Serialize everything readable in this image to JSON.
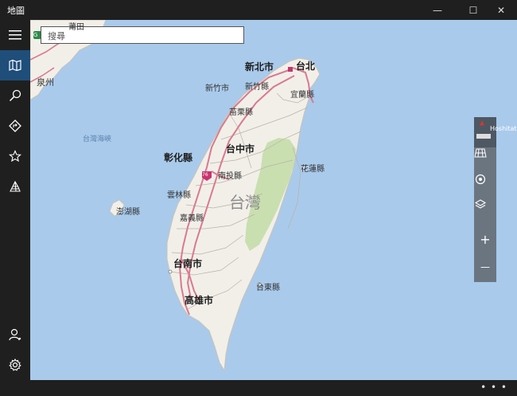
{
  "app": {
    "title": "地圖"
  },
  "window_controls": {
    "minimize": "—",
    "maximize": "☐",
    "close": "✕"
  },
  "search": {
    "placeholder": "搜尋"
  },
  "sidebar": {
    "items": [
      {
        "name": "hamburger-menu-icon",
        "active": false
      },
      {
        "name": "map-icon",
        "active": true
      },
      {
        "name": "search-icon",
        "active": false
      },
      {
        "name": "directions-icon",
        "active": false
      },
      {
        "name": "favorites-star-icon",
        "active": false
      },
      {
        "name": "3d-cities-icon",
        "active": false
      }
    ],
    "bottom_items": [
      {
        "name": "account-icon"
      },
      {
        "name": "settings-gear-icon"
      }
    ]
  },
  "map": {
    "labels": {
      "taipei": "台北",
      "new_taipei": "新北市",
      "hsinchu_city": "新竹市",
      "hsinchu_county": "新竹縣",
      "yilan": "宜蘭縣",
      "miaoli": "苗栗縣",
      "taichung": "台中市",
      "changhua": "彰化縣",
      "nantou": "南投縣",
      "hualien": "花蓮縣",
      "yunlin": "雲林縣",
      "chiayi": "嘉義縣",
      "penghu": "澎湖縣",
      "tainan": "台南市",
      "kaohsiung": "高雄市",
      "taitung": "台東縣",
      "strait": "台灣海峽",
      "island": "台灣",
      "quanzhou": "泉州",
      "putian": "莆田",
      "highway_shield": "76",
      "china_shield": "G"
    },
    "colors": {
      "water": "#a9caeb",
      "land": "#f2efe9",
      "park": "#c9dfb0",
      "highway": "#d97a8f",
      "accent": "#1f4e7a"
    }
  },
  "map_controls": {
    "compass_label": "Hoshitat",
    "buttons": [
      {
        "name": "tilt-3d-grid-icon"
      },
      {
        "name": "my-location-icon"
      },
      {
        "name": "map-layers-icon"
      },
      {
        "name": "zoom-in-icon",
        "glyph": "+"
      },
      {
        "name": "zoom-out-icon",
        "glyph": "—"
      }
    ]
  },
  "bottom": {
    "more": "• • •"
  }
}
